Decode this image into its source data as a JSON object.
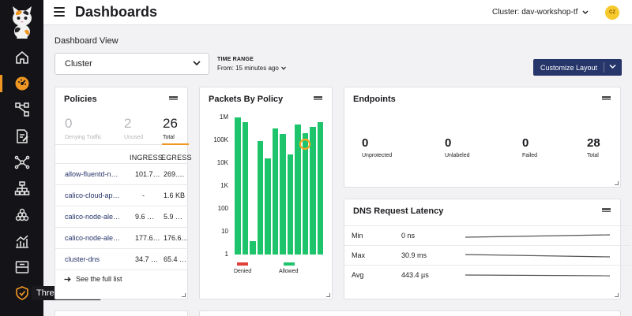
{
  "sidebar": {
    "items": [
      {
        "icon": "home-icon"
      },
      {
        "icon": "dashboard-icon",
        "active": true
      },
      {
        "icon": "service-graph-icon"
      },
      {
        "icon": "policy-icon"
      },
      {
        "icon": "network-icon"
      },
      {
        "icon": "topology-icon"
      },
      {
        "icon": "kibana-icon"
      },
      {
        "icon": "chart-icon"
      },
      {
        "icon": "inbox-icon"
      },
      {
        "icon": "shield-icon"
      }
    ],
    "tooltip": "Threat Defense",
    "accent": "#f09622"
  },
  "header": {
    "title": "Dashboards",
    "cluster_label": "Cluster: dav-workshop-tf",
    "avatar_initials": "CZ"
  },
  "controls": {
    "section_label": "Dashboard View",
    "dashboard_select": "Cluster",
    "time_range_label": "TIME RANGE",
    "time_range_value": "From: 15 minutes ago",
    "customize_label": "Customize Layout",
    "button_color": "#26356a"
  },
  "policies": {
    "title": "Policies",
    "stats": [
      {
        "value": "0",
        "label": "Denying Traffic"
      },
      {
        "value": "2",
        "label": "Unused"
      },
      {
        "value": "26",
        "label": "Total"
      }
    ],
    "columns": [
      "INGRESS",
      "EGRESS"
    ],
    "rows": [
      {
        "name": "allow-fluentd-n…",
        "ingress": "101.7…",
        "egress": "269.…"
      },
      {
        "name": "calico-cloud-ap…",
        "ingress": "-",
        "egress": "1.6 KB"
      },
      {
        "name": "calico-node-ale…",
        "ingress": "9.6 …",
        "egress": "5.9 …"
      },
      {
        "name": "calico-node-ale…",
        "ingress": "177.6…",
        "egress": "176.6…"
      },
      {
        "name": "cluster-dns",
        "ingress": "34.7 …",
        "egress": "65.4 …"
      }
    ],
    "see_full": "See the full list"
  },
  "packets": {
    "title": "Packets By Policy",
    "legend_denied": "Denied",
    "legend_allowed": "Allowed",
    "denied_color": "#e0413a",
    "allowed_color": "#1ec46b",
    "highlight_color": "#f5a623"
  },
  "chart_data": {
    "type": "bar",
    "title": "Packets By Policy",
    "yscale": "log",
    "ylim": [
      1,
      2000000
    ],
    "yticks": [
      "1M",
      "100K",
      "10K",
      "1K",
      "100",
      "10",
      "1"
    ],
    "series": [
      {
        "name": "Denied",
        "values": [
          0,
          0,
          0,
          0,
          0,
          0,
          0,
          0,
          0,
          0,
          0,
          0
        ]
      },
      {
        "name": "Allowed",
        "values": [
          1000000,
          600000,
          4,
          95000,
          16000,
          320000,
          190000,
          24000,
          500000,
          200000,
          400000,
          600000
        ]
      }
    ],
    "highlight_index": 9
  },
  "endpoints": {
    "title": "Endpoints",
    "stats": [
      {
        "value": "0",
        "label": "Unprotected"
      },
      {
        "value": "0",
        "label": "Unlabeled"
      },
      {
        "value": "0",
        "label": "Failed"
      },
      {
        "value": "28",
        "label": "Total"
      }
    ]
  },
  "dns": {
    "title": "DNS Request Latency",
    "rows": [
      {
        "label": "Min",
        "value": "0 ns"
      },
      {
        "label": "Max",
        "value": "30.9 ms"
      },
      {
        "label": "Avg",
        "value": "443.4 µs"
      }
    ]
  }
}
